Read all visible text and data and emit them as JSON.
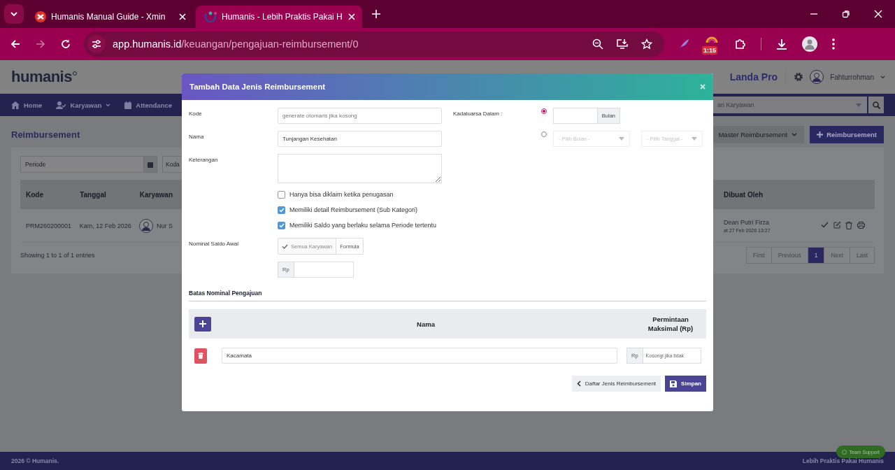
{
  "browser": {
    "tabs": [
      {
        "title": "Humanis Manual Guide - Xmin",
        "selected": false,
        "kind": "xmind"
      },
      {
        "title": "Humanis - Lebih Praktis Pakai H",
        "selected": true,
        "kind": "humanis"
      }
    ],
    "url": {
      "host": "app.humanis.id",
      "path": "/keuangan/pengajuan-reimbursement/0"
    },
    "extension_badge": "1:15"
  },
  "header": {
    "logo": "humanis",
    "company": "Landa Pro",
    "user": "Fahturrohman"
  },
  "nav": [
    {
      "label": "Home",
      "dropdown": false,
      "kind": "home"
    },
    {
      "label": "Karyawan",
      "dropdown": true,
      "kind": "user"
    },
    {
      "label": "Attendance",
      "dropdown": false,
      "kind": "calendar"
    }
  ],
  "search": {
    "placeholder": "ari Karyawan"
  },
  "page": {
    "title": "Reimbursement",
    "buttons": [
      "Master Reimbursement",
      "Reimbursement"
    ],
    "filters": [
      "Periode",
      "Koda"
    ],
    "table": {
      "columns_left": [
        "Kode",
        "Tanggal",
        "Karyawan"
      ],
      "columns_right": [
        "Dibuat Oleh"
      ],
      "rows": [
        {
          "kode": "PRM260200001",
          "tanggal": "Kam, 12 Feb 2026",
          "karyawan": "Nur S",
          "dibuat_oleh": "Dean Putri Firza",
          "dibuat_at": "at 27 Feb 2026 13:27"
        }
      ]
    },
    "info": "Showing 1 to 1 of 1 entries",
    "pagination": [
      {
        "label": "First",
        "selected": false,
        "disabled": true
      },
      {
        "label": "Previous",
        "selected": false,
        "disabled": true
      },
      {
        "label": "1",
        "selected": true,
        "disabled": false
      },
      {
        "label": "Next",
        "selected": false,
        "disabled": true
      },
      {
        "label": "Last",
        "selected": false,
        "disabled": true
      }
    ]
  },
  "footer": {
    "left": "2026 © Humanis.",
    "right": "Lebih Praktis Pakai Humanis",
    "support": "Team Support"
  },
  "modal": {
    "title": "Tambah Data Jenis Reimbursement",
    "kode": {
      "label": "Kode",
      "placeholder": "generate otomaris jika kosong"
    },
    "nama": {
      "label": "Nama",
      "value": "Tunjangan Kesehatan"
    },
    "keterangan": {
      "label": "Keterangan"
    },
    "checkboxes": [
      {
        "label": "Hanya bisa diklaim ketika penugasan",
        "checked": false
      },
      {
        "label": "Memiliki detail Reimbursement (Sub Kategori)",
        "checked": true
      },
      {
        "label": "Memiliki Saldo yang berlaku selama Periode tertentu",
        "checked": true
      }
    ],
    "saldo": {
      "label": "Nominal Saldo Awal",
      "options": [
        {
          "label": "Semua Karyawan",
          "selected": true
        },
        {
          "label": "Formula",
          "selected": false
        }
      ],
      "currency": "Rp"
    },
    "expiry": {
      "label": "Kadaluarsa Dalam :",
      "options": [
        {
          "kind": "months",
          "selected": true,
          "unit": "Bulan"
        },
        {
          "kind": "date",
          "selected": false,
          "month_placeholder": "- Pilih Bulan -",
          "date_placeholder": "- Pilih Tanggal -"
        }
      ]
    },
    "limits": {
      "title": "Batas Nominal Pengajuan",
      "columns": [
        "Nama",
        "Permintaan Maksimal (Rp)"
      ],
      "rows": [
        {
          "nama": "Kacamata",
          "currency": "Rp",
          "placeholder": "Kosongi jika tidak"
        }
      ]
    },
    "buttons": {
      "back": "Daftar Jenis Reimbursement",
      "save": "Simpan"
    }
  }
}
